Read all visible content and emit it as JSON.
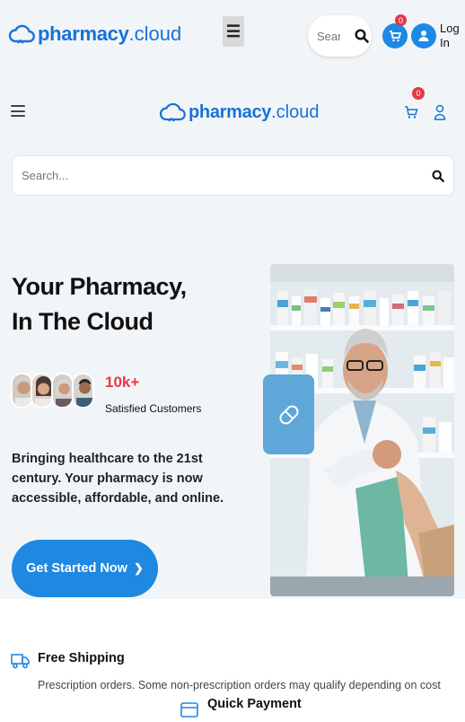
{
  "brand": {
    "name_bold": "pharmacy",
    "name_light": ".cloud",
    "color": "#1872d8"
  },
  "topbar": {
    "search_placeholder": "Search",
    "cart_count": "0",
    "login_label": "Log In"
  },
  "header": {
    "cart_count": "0"
  },
  "search": {
    "placeholder": "Search..."
  },
  "hero": {
    "title_line1": "Your Pharmacy,",
    "title_line2": "In The Cloud",
    "stat_value": "10k+",
    "stat_label": "Satisfied Customers",
    "description": "Bringing healthcare to the 21st century. Your pharmacy is now accessible, affordable, and online.",
    "cta_label": "Get Started Now",
    "cta_arrow": "❯"
  },
  "features": [
    {
      "icon": "truck-icon",
      "title": "Free Shipping",
      "description": "Prescription orders. Some non-prescription orders may qualify depending on cost"
    },
    {
      "icon": "credit-card-icon",
      "title": "Quick Payment",
      "description": ""
    }
  ],
  "colors": {
    "accent": "#1f88e0",
    "badge": "#e53946",
    "highlight": "#e53946"
  }
}
